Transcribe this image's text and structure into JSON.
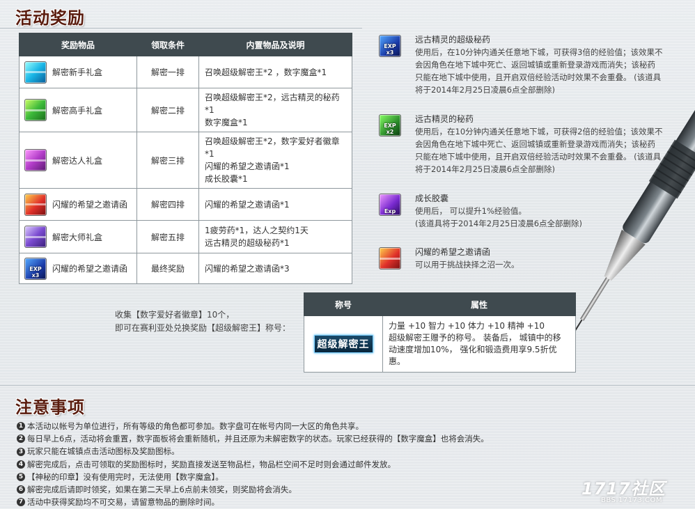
{
  "section_titles": {
    "rewards": "活动奖励",
    "notice": "注意事项"
  },
  "reward_table": {
    "headers": [
      "奖励物品",
      "领取条件",
      "内置物品及说明"
    ],
    "rows": [
      {
        "icon": "cyan-gift-box-icon",
        "item": "解密新手礼盒",
        "condition": "解密一排",
        "contents": [
          "召唤超级解密王*2 ，数字魔盒*1"
        ]
      },
      {
        "icon": "green-gift-box-icon",
        "item": "解密高手礼盒",
        "condition": "解密二排",
        "contents": [
          "召唤超级解密王*2，远古精灵的秘药*1",
          "数字魔盒*1"
        ]
      },
      {
        "icon": "purple-gift-box-icon",
        "item": "解密达人礼盒",
        "condition": "解密三排",
        "contents": [
          "召唤超级解密王*2，数字爱好者徽章*1",
          "闪耀的希望之邀请函*1",
          "成长胶囊*1"
        ]
      },
      {
        "icon": "invitation-letter-icon",
        "item": "闪耀的希望之邀请函",
        "condition": "解密四排",
        "contents": [
          "闪耀的希望之邀请函*1"
        ]
      },
      {
        "icon": "violet-gift-box-icon",
        "item": "解密大师礼盒",
        "condition": "解密五排",
        "contents": [
          "1疲劳药*1，达人之契约1天",
          "远古精灵的超级秘药*1"
        ]
      },
      {
        "icon": "super-potion-icon",
        "item": "闪耀的希望之邀请函",
        "condition": "最终奖励",
        "contents": [
          "闪耀的希望之邀请函*3"
        ]
      }
    ]
  },
  "item_descriptions": [
    {
      "icon": "super-potion-icon",
      "glyph": "EXP x3",
      "title": "远古精灵的超级秘药",
      "lines": [
        "使用后，在10分钟内通关任意地下城，可获得3倍的经验值；该效果不",
        "会因角色在地下城中死亡、返回城镇或重新登录游戏而消失；该秘药",
        "只能在地下城中使用，且开启双倍经验活动时效果不会重叠。 (该道具",
        "将于2014年2月25日凌晨6点全部删除)"
      ]
    },
    {
      "icon": "potion-icon",
      "glyph": "EXP x2",
      "title": "远古精灵的秘药",
      "lines": [
        "使用后，在10分钟内通关任意地下城，可获得2倍的经验值；该效果不",
        "会因角色在地下城中死亡、返回城镇或重新登录游戏而消失；该秘药",
        "只能在地下城中使用，且开启双倍经验活动时效果不会重叠。 (该道具",
        "将于2014年2月25日凌晨6点全部删除)"
      ]
    },
    {
      "icon": "exp-capsule-icon",
      "glyph": "Exp",
      "title": "成长胶囊",
      "lines": [
        "使用后， 可以提升1%经验值。",
        "(该道具将于2014年2月25日凌晨6点全部删除)"
      ]
    },
    {
      "icon": "invitation-letter-icon",
      "glyph": "",
      "title": "闪耀的希望之邀请函",
      "lines": [
        "可以用于挑战抉择之沼一次。"
      ]
    }
  ],
  "collect_text": [
    "收集【数字爱好者徽章】10个，",
    "即可在赛利亚处兑换奖励【超级解密王】称号："
  ],
  "title_table": {
    "headers": [
      "称号",
      "属性"
    ],
    "badge": "超级解密王",
    "attributes": [
      "力量 +10 智力 +10 体力 +10 精神 +10",
      "超级解密王赠予的称号。 装备后， 城镇中的移",
      "动速度增加10%， 强化和锻造费用享9.5折优惠。"
    ]
  },
  "notes": [
    {
      "num": "1",
      "text": "本活动以帐号为单位进行，所有等级的角色都可参加。数字盘可在帐号内同一大区的角色共享。"
    },
    {
      "num": "2",
      "text": "每日早上6点，活动将会重置，数字面板将会重新随机，并且还原为未解密数字的状态。玩家已经获得的【数字魔盒】也将会消失。"
    },
    {
      "num": "3",
      "text": "玩家只能在城镇点击活动图标及奖励图标。"
    },
    {
      "num": "4",
      "text": "解密完成后，点击可领取的奖励图标时，奖励直接发送至物品栏，物品栏空间不足时则会通过邮件发放。"
    },
    {
      "num": "5",
      "text": "【神秘的印章】没有使用完时，无法使用【数字魔盒】。"
    },
    {
      "num": "6",
      "text": "解密完成后请即时领奖，如果在第二天早上6点前未领奖，则奖励将会消失。"
    },
    {
      "num": "7",
      "text": "活动中获得奖励均不可交易，请留意物品的删除时间。"
    }
  ],
  "watermark": {
    "logo": "1717社区",
    "url": "BBS.17173.COM"
  }
}
